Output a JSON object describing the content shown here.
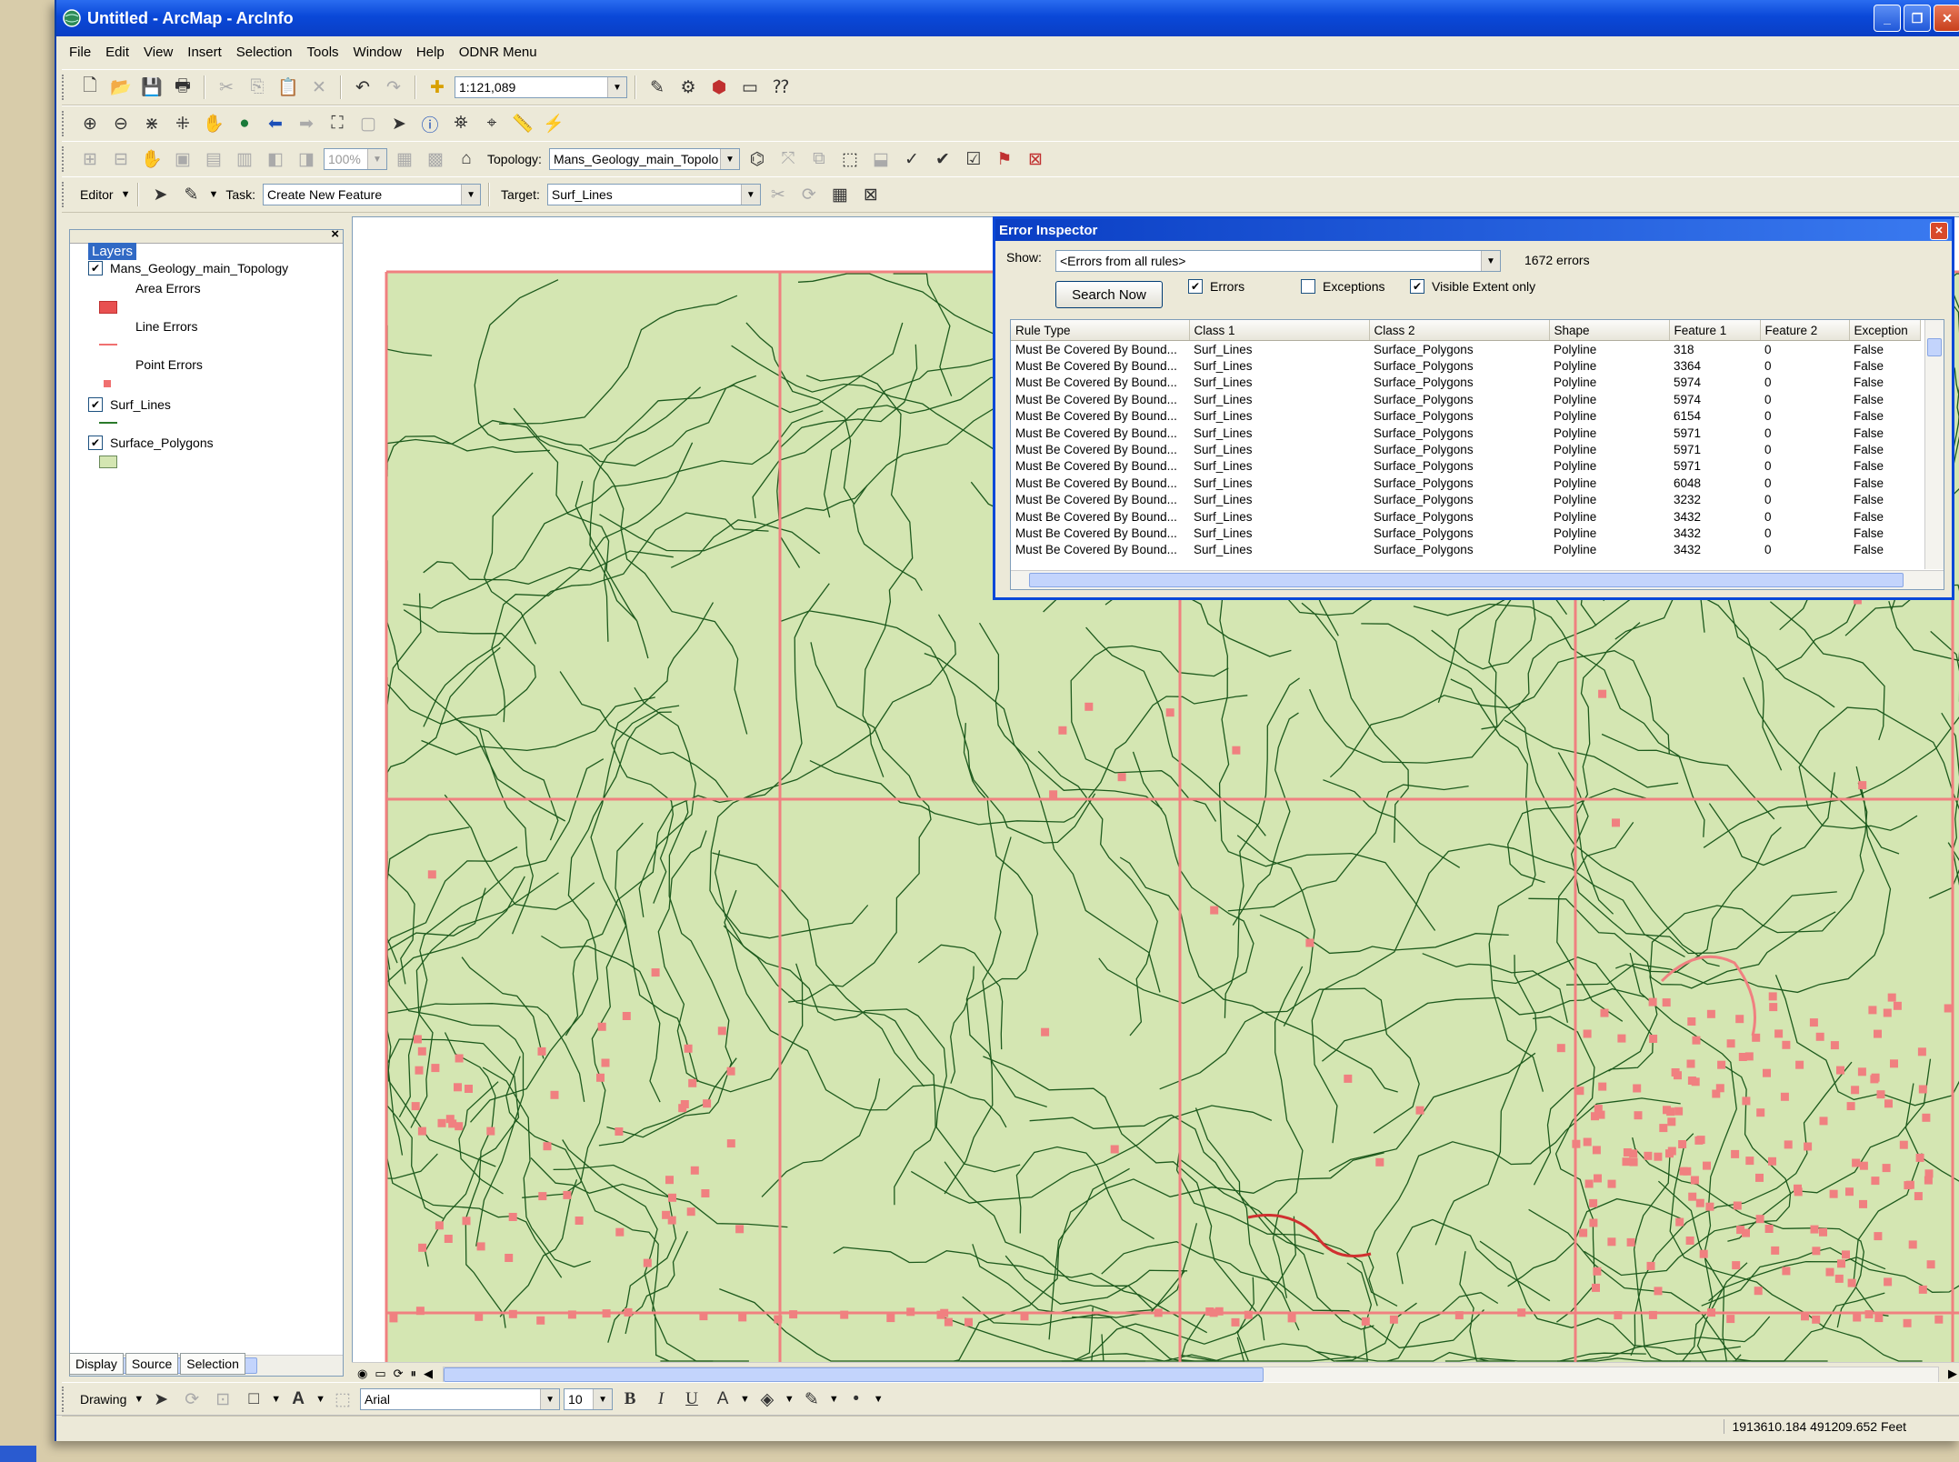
{
  "window": {
    "title": "Untitled - ArcMap - ArcInfo"
  },
  "menu": [
    "File",
    "Edit",
    "View",
    "Insert",
    "Selection",
    "Tools",
    "Window",
    "Help",
    "ODNR Menu"
  ],
  "standard_toolbar": {
    "scale": "1:121,089"
  },
  "topology_toolbar": {
    "zoom": "100%",
    "topology_label": "Topology:",
    "topology_value": "Mans_Geology_main_Topolo"
  },
  "editor_toolbar": {
    "editor_label": "Editor",
    "task_label": "Task:",
    "task_value": "Create New Feature",
    "target_label": "Target:",
    "target_value": "Surf_Lines"
  },
  "toc": {
    "title": "Layers",
    "topology_layer": "Mans_Geology_main_Topology",
    "legend": [
      "Area Errors",
      "Line Errors",
      "Point Errors"
    ],
    "layers": [
      "Surf_Lines",
      "Surface_Polygons"
    ],
    "tabs": [
      "Display",
      "Source",
      "Selection"
    ]
  },
  "error_inspector": {
    "title": "Error Inspector",
    "show_label": "Show:",
    "show_value": "<Errors from all rules>",
    "count": "1672 errors",
    "search_button": "Search Now",
    "checkboxes": {
      "errors": "Errors",
      "exceptions": "Exceptions",
      "visible_extent": "Visible Extent only"
    },
    "columns": [
      "Rule Type",
      "Class 1",
      "Class 2",
      "Shape",
      "Feature 1",
      "Feature 2",
      "Exception"
    ],
    "rows": [
      [
        "Must Be Covered By Bound...",
        "Surf_Lines",
        "Surface_Polygons",
        "Polyline",
        "318",
        "0",
        "False"
      ],
      [
        "Must Be Covered By Bound...",
        "Surf_Lines",
        "Surface_Polygons",
        "Polyline",
        "3364",
        "0",
        "False"
      ],
      [
        "Must Be Covered By Bound...",
        "Surf_Lines",
        "Surface_Polygons",
        "Polyline",
        "5974",
        "0",
        "False"
      ],
      [
        "Must Be Covered By Bound...",
        "Surf_Lines",
        "Surface_Polygons",
        "Polyline",
        "5974",
        "0",
        "False"
      ],
      [
        "Must Be Covered By Bound...",
        "Surf_Lines",
        "Surface_Polygons",
        "Polyline",
        "6154",
        "0",
        "False"
      ],
      [
        "Must Be Covered By Bound...",
        "Surf_Lines",
        "Surface_Polygons",
        "Polyline",
        "5971",
        "0",
        "False"
      ],
      [
        "Must Be Covered By Bound...",
        "Surf_Lines",
        "Surface_Polygons",
        "Polyline",
        "5971",
        "0",
        "False"
      ],
      [
        "Must Be Covered By Bound...",
        "Surf_Lines",
        "Surface_Polygons",
        "Polyline",
        "5971",
        "0",
        "False"
      ],
      [
        "Must Be Covered By Bound...",
        "Surf_Lines",
        "Surface_Polygons",
        "Polyline",
        "6048",
        "0",
        "False"
      ],
      [
        "Must Be Covered By Bound...",
        "Surf_Lines",
        "Surface_Polygons",
        "Polyline",
        "3232",
        "0",
        "False"
      ],
      [
        "Must Be Covered By Bound...",
        "Surf_Lines",
        "Surface_Polygons",
        "Polyline",
        "3432",
        "0",
        "False"
      ],
      [
        "Must Be Covered By Bound...",
        "Surf_Lines",
        "Surface_Polygons",
        "Polyline",
        "3432",
        "0",
        "False"
      ],
      [
        "Must Be Covered By Bound...",
        "Surf_Lines",
        "Surface_Polygons",
        "Polyline",
        "3432",
        "0",
        "False"
      ]
    ]
  },
  "drawing_toolbar": {
    "drawing_label": "Drawing",
    "font": "Arial",
    "font_size": "10",
    "bold": "B",
    "italic": "I",
    "underline": "U"
  },
  "status": {
    "coords": "1913610.184  491209.652 Feet"
  },
  "colors": {
    "map_fill": "#d4e6b2",
    "map_lines": "#1d5a1d",
    "error": "#f08080",
    "title_blue": "#0a48d8"
  }
}
